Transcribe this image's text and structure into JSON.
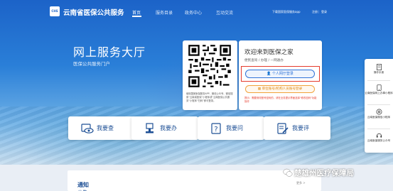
{
  "header": {
    "logo_text": "CHS",
    "title": "云南省医保公共服务",
    "nav": [
      "首页",
      "服务目录",
      "政务中心",
      "互动交流"
    ],
    "app_download": "下载国家医保服务app",
    "register": "注册",
    "login": "登录"
  },
  "hero": {
    "title": "网上服务大厅",
    "subtitle": "医保公共服务门户"
  },
  "qr_card": {
    "text": "使用国家医保服务APP、微信公众号、微信搜索“云南省医保”小程序或“云南医保公共服务”小程序“扫码”即可登录。"
  },
  "login_card": {
    "welcome": "欢迎来到医保之家",
    "subtitle": "便民查询 / 办理 / 一网通办",
    "personal_login": "个人网厅登录",
    "unit_login": "单位账号/机构人员账号登录",
    "notice": "提示：需要修改账号密码的，请在业务提示界面选择\"修改密码\"功能操作"
  },
  "features": [
    {
      "label": "我要查",
      "icon": "eye-icon"
    },
    {
      "label": "我要办",
      "icon": "stamp-icon"
    },
    {
      "label": "我要问",
      "icon": "question-icon"
    },
    {
      "label": "我要评",
      "icon": "review-icon"
    }
  ],
  "sidebar": [
    {
      "label": "操作手册",
      "icon": "manual-icon"
    },
    {
      "label": "云南医保网上办事小程序",
      "icon": "mini-program-icon"
    },
    {
      "label": "云南医保微信小程序",
      "icon": "wechat-mini-icon"
    },
    {
      "label": "云南医保服务公众号",
      "icon": "official-account-icon"
    }
  ],
  "bottom": {
    "notice_title": "通知",
    "notice_title_2": "公告",
    "more": "更多 >"
  },
  "watermark": "楚雄州医疗保障局",
  "colors": {
    "primary_blue": "#1d63c6",
    "highlight_red": "#e53b2c",
    "unit_orange": "#f0a23a"
  }
}
